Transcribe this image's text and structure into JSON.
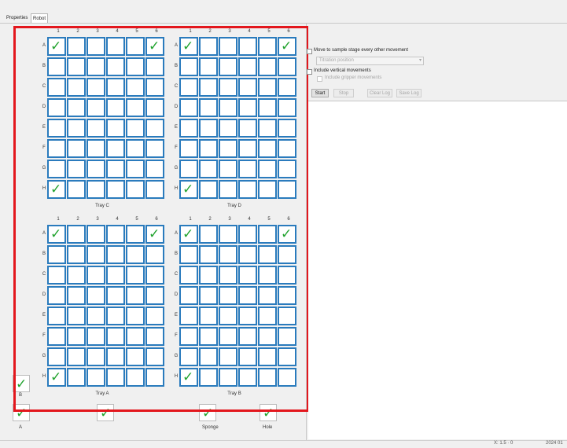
{
  "tabs": [
    "Properties",
    "Robot"
  ],
  "cols": [
    "1",
    "2",
    "3",
    "4",
    "5",
    "6"
  ],
  "rows": [
    "A",
    "B",
    "C",
    "D",
    "E",
    "F",
    "G",
    "H"
  ],
  "trays": [
    {
      "name": "Tray C",
      "checked": [
        "A1",
        "A6",
        "H1"
      ]
    },
    {
      "name": "Tray D",
      "checked": [
        "A1",
        "A6",
        "H1"
      ]
    },
    {
      "name": "Tray A",
      "checked": [
        "A1",
        "A6",
        "H1"
      ]
    },
    {
      "name": "Tray B",
      "checked": [
        "A1",
        "A6",
        "H1"
      ]
    }
  ],
  "wells": [
    {
      "label": "B",
      "checked": true
    },
    {
      "label": "A",
      "checked": true
    },
    {
      "label": "",
      "checked": true
    },
    {
      "label": "Sponge",
      "checked": true
    },
    {
      "label": "Hole",
      "checked": true
    }
  ],
  "controls": {
    "move_label": "Move to sample stage every other movement",
    "move_checked": false,
    "position_value": "Titration position",
    "vertical_label": "Include vertical movements",
    "vertical_checked": false,
    "gripper_label": "Include gripper movements",
    "gripper_checked": false
  },
  "buttons": {
    "start": "Start",
    "stop": "Stop",
    "clear_log": "Clear Log",
    "save_log": "Save Log"
  },
  "status": {
    "left": "X: 1.5 · 0",
    "right": "2024 01"
  },
  "colors": {
    "frame": "#e3171d",
    "cell_border": "#2a7bbd",
    "check": "#22a32f"
  }
}
